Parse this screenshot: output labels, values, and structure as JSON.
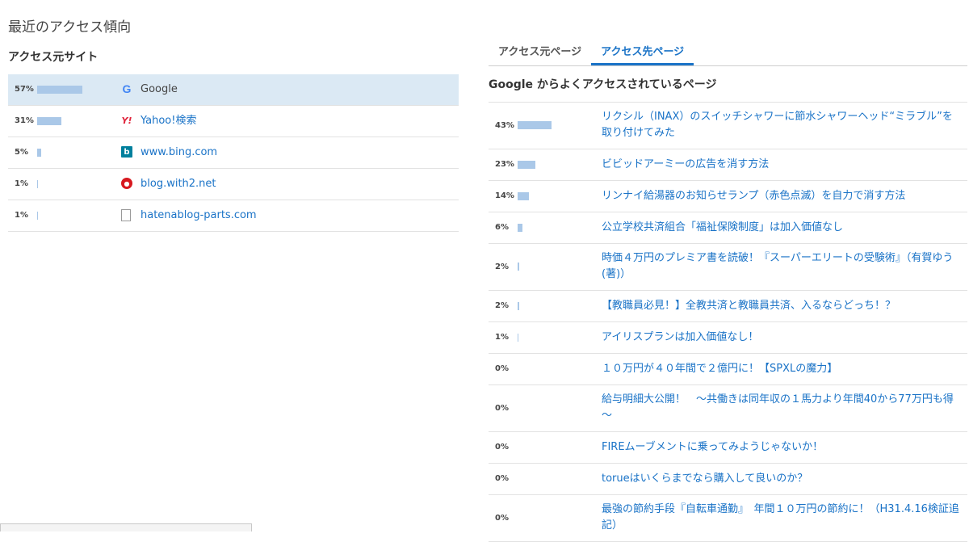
{
  "page_title": "最近のアクセス傾向",
  "left": {
    "heading": "アクセス元サイト",
    "items": [
      {
        "pct": "57%",
        "value": 57,
        "icon": "google-icon",
        "label": "Google",
        "link": false
      },
      {
        "pct": "31%",
        "value": 31,
        "icon": "yahoo-icon",
        "label": "Yahoo!検索",
        "link": true
      },
      {
        "pct": "5%",
        "value": 5,
        "icon": "bing-icon",
        "label": "www.bing.com",
        "link": true
      },
      {
        "pct": "1%",
        "value": 1,
        "icon": "with2-icon",
        "label": "blog.with2.net",
        "link": true
      },
      {
        "pct": "1%",
        "value": 1,
        "icon": "file-icon",
        "label": "hatenablog-parts.com",
        "link": true
      }
    ]
  },
  "right": {
    "tabs": [
      {
        "label": "アクセス元ページ",
        "active": false
      },
      {
        "label": "アクセス先ページ",
        "active": true
      }
    ],
    "heading": "Google からよくアクセスされているページ",
    "items": [
      {
        "pct": "43%",
        "value": 43,
        "title": "リクシル（INAX）のスイッチシャワーに節水シャワーヘッド“ミラブル”を取り付けてみた",
        "lines": 2
      },
      {
        "pct": "23%",
        "value": 23,
        "title": "ビビッドアーミーの広告を消す方法",
        "lines": 1
      },
      {
        "pct": "14%",
        "value": 14,
        "title": "リンナイ給湯器のお知らせランプ（赤色点滅）を自力で消す方法",
        "lines": 1
      },
      {
        "pct": "6%",
        "value": 6,
        "title": "公立学校共済組合「福祉保険制度」は加入価値なし",
        "lines": 1
      },
      {
        "pct": "2%",
        "value": 2,
        "title": "時価４万円のプレミア書を読破！『スーパーエリートの受験術』（有賀ゆう (著)）",
        "lines": 2
      },
      {
        "pct": "2%",
        "value": 2,
        "title": "【教職員必見！】全教共済と教職員共済、入るならどっち！？",
        "lines": 1
      },
      {
        "pct": "1%",
        "value": 1,
        "title": "アイリスプランは加入価値なし！",
        "lines": 1
      },
      {
        "pct": "0%",
        "value": 0,
        "title": "１０万円が４０年間で２億円に！【SPXLの魔力】",
        "lines": 1
      },
      {
        "pct": "0%",
        "value": 0,
        "title": "給与明細大公開！　～共働きは同年収の１馬力より年間40から77万円も得～",
        "lines": 2
      },
      {
        "pct": "0%",
        "value": 0,
        "title": "FIREムーブメントに乗ってみようじゃないか！",
        "lines": 1
      },
      {
        "pct": "0%",
        "value": 0,
        "title": "torueはいくらまでなら購入して良いのか？",
        "lines": 1
      },
      {
        "pct": "0%",
        "value": 0,
        "title": "最強の節約手段『自転車通勤』　年間１０万円の節約に！（H31.4.16検証追記）",
        "lines": 2
      }
    ]
  },
  "colors": {
    "bar": "#aac8e8",
    "link": "#1a73c7",
    "selected_row": "#dbe9f4"
  }
}
